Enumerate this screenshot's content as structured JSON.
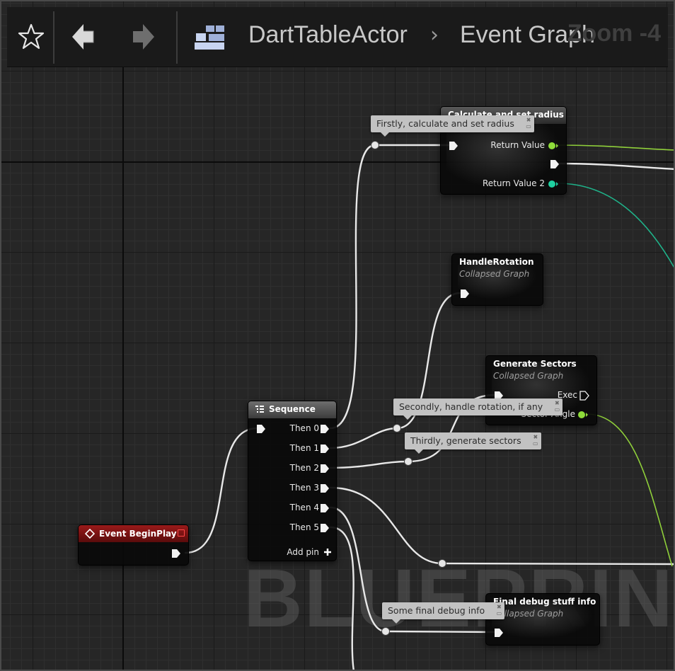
{
  "toolbar": {
    "favorite_icon": "star-outline-icon",
    "back_icon": "arrow-left-icon",
    "forward_icon": "arrow-right-icon",
    "hierarchy_icon": "class-hierarchy-icon",
    "breadcrumb_parent": "DartTableActor",
    "breadcrumb_separator": "›",
    "breadcrumb_current": "Event Graph",
    "zoom_label": "Zoom -4"
  },
  "watermark": "BLUEPRINT",
  "nodes": {
    "event_begin_play": {
      "title": "Event BeginPlay"
    },
    "sequence": {
      "title": "Sequence",
      "outputs": [
        "Then 0",
        "Then 1",
        "Then 2",
        "Then 3",
        "Then 4",
        "Then 5"
      ],
      "add_pin_label": "Add pin"
    },
    "calculate_radius": {
      "title": "Calculate and set radius",
      "return_value_label": "Return Value",
      "return_value2_label": "Return Value 2"
    },
    "handle_rotation": {
      "title": "HandleRotation",
      "subtitle": "Collapsed Graph"
    },
    "generate_sectors": {
      "title": "Generate Sectors",
      "subtitle": "Collapsed Graph",
      "exec_label": "Exec",
      "sector_angle_label": "Sector Angle"
    },
    "final_debug": {
      "title": "Final debug stuff info",
      "subtitle": "Collapsed Graph"
    }
  },
  "comments": {
    "radius": "Firstly, calculate and set radius",
    "rotation": "Secondly, handle rotation, if any",
    "sectors": "Thirdly, generate sectors",
    "debug": "Some final debug info"
  },
  "colors": {
    "canvas": "#262626",
    "exec_wire": "#e8e8e8",
    "float_wire": "#8fcf3a",
    "vector_wire": "#1fb38a",
    "event_header": "#7a1212",
    "comment_bubble": "#c2c2c2"
  }
}
